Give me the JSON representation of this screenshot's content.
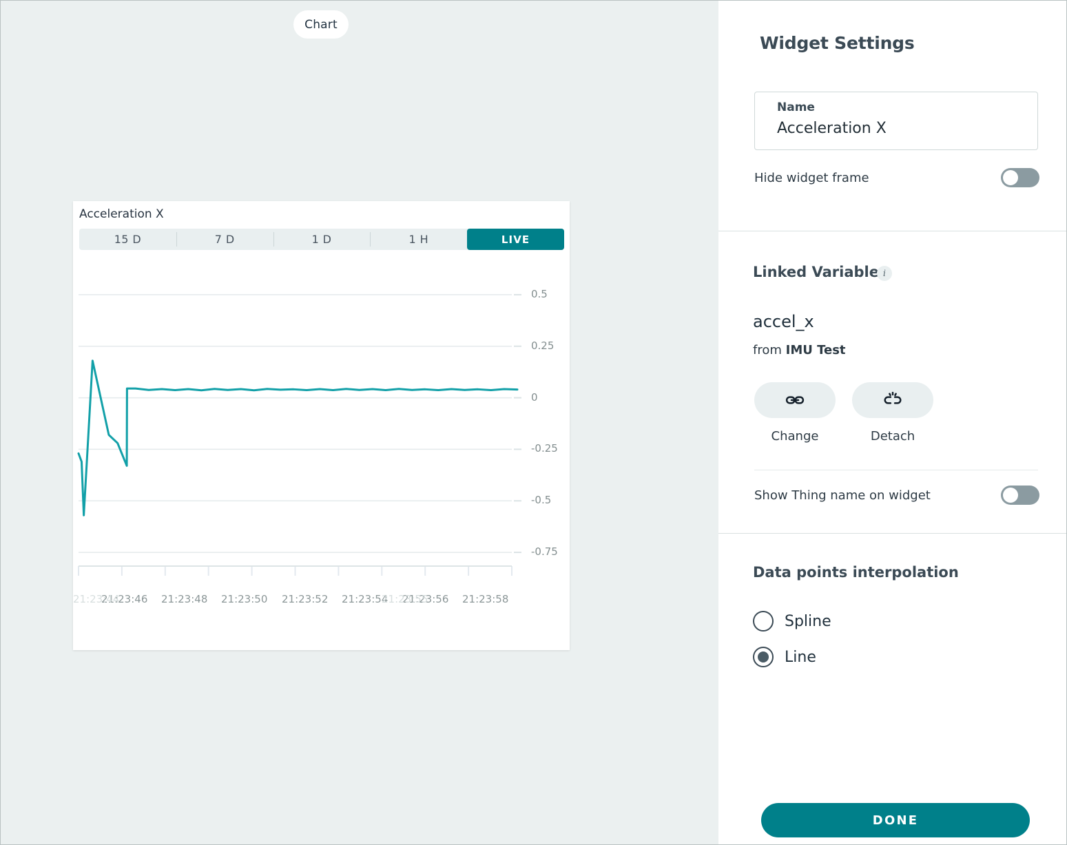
{
  "canvas": {
    "tab_label": "Chart"
  },
  "widget": {
    "title": "Acceleration X",
    "ranges": [
      {
        "label": "15 D",
        "active": false
      },
      {
        "label": "7 D",
        "active": false
      },
      {
        "label": "1 D",
        "active": false
      },
      {
        "label": "1 H",
        "active": false
      },
      {
        "label": "LIVE",
        "active": true
      }
    ]
  },
  "panel": {
    "title": "Widget Settings",
    "name_label": "Name",
    "name_value": "Acceleration X",
    "hide_widget_frame_label": "Hide widget frame",
    "hide_widget_frame_state": "off",
    "linked_variable_title": "Linked Variable",
    "info_icon": "i",
    "variable_name": "accel_x",
    "from_prefix": "from ",
    "from_thing": "IMU Test",
    "change_label": "Change",
    "detach_label": "Detach",
    "change_icon": "link-icon",
    "detach_icon": "broken-link-icon",
    "show_thing_name_label": "Show Thing name on widget",
    "show_thing_name_state": "off",
    "interpolation_title": "Data points interpolation",
    "options": [
      {
        "label": "Spline",
        "selected": false
      },
      {
        "label": "Line",
        "selected": true
      }
    ],
    "done_label": "DONE",
    "accent_color": "#00808a"
  },
  "chart_data": {
    "type": "line",
    "title": "Acceleration X",
    "xlabel": "",
    "ylabel": "",
    "grid": true,
    "legend": "none",
    "line_color": "#12a0a8",
    "ylim": [
      -0.85,
      0.62
    ],
    "yticks": [
      0.5,
      0.25,
      0,
      -0.25,
      -0.5,
      -0.75
    ],
    "ytick_labels": [
      "0.5",
      "0.25",
      "0",
      "-0.25",
      "-0.5",
      "-0.75"
    ],
    "xtick_labels": [
      "21:23:46",
      "21:23:48",
      "21:23:50",
      "21:23:52",
      "21:23:54",
      "21:23:56",
      "21:23:58"
    ],
    "xtick_labels_faded": [
      "21:23:44",
      "21:23:55"
    ],
    "x": [
      0.0,
      0.7,
      1.2,
      3.2,
      6.9,
      8.9,
      11.0,
      11.05,
      13.0,
      16.0,
      19.0,
      22.0,
      25.0,
      28.0,
      31.0,
      34.0,
      37.0,
      40.0,
      43.0,
      46.0,
      49.0,
      52.0,
      55.0,
      58.0,
      61.0,
      64.0,
      67.0,
      70.0,
      73.0,
      76.0,
      79.0,
      82.0,
      85.0,
      88.0,
      91.0,
      94.0,
      97.0,
      100.0
    ],
    "y": [
      -0.27,
      -0.31,
      -0.57,
      0.18,
      -0.18,
      -0.22,
      -0.33,
      0.045,
      0.045,
      0.038,
      0.042,
      0.037,
      0.042,
      0.036,
      0.043,
      0.038,
      0.042,
      0.036,
      0.043,
      0.039,
      0.041,
      0.037,
      0.042,
      0.037,
      0.043,
      0.038,
      0.042,
      0.037,
      0.043,
      0.038,
      0.041,
      0.037,
      0.042,
      0.038,
      0.041,
      0.037,
      0.042,
      0.04
    ]
  }
}
